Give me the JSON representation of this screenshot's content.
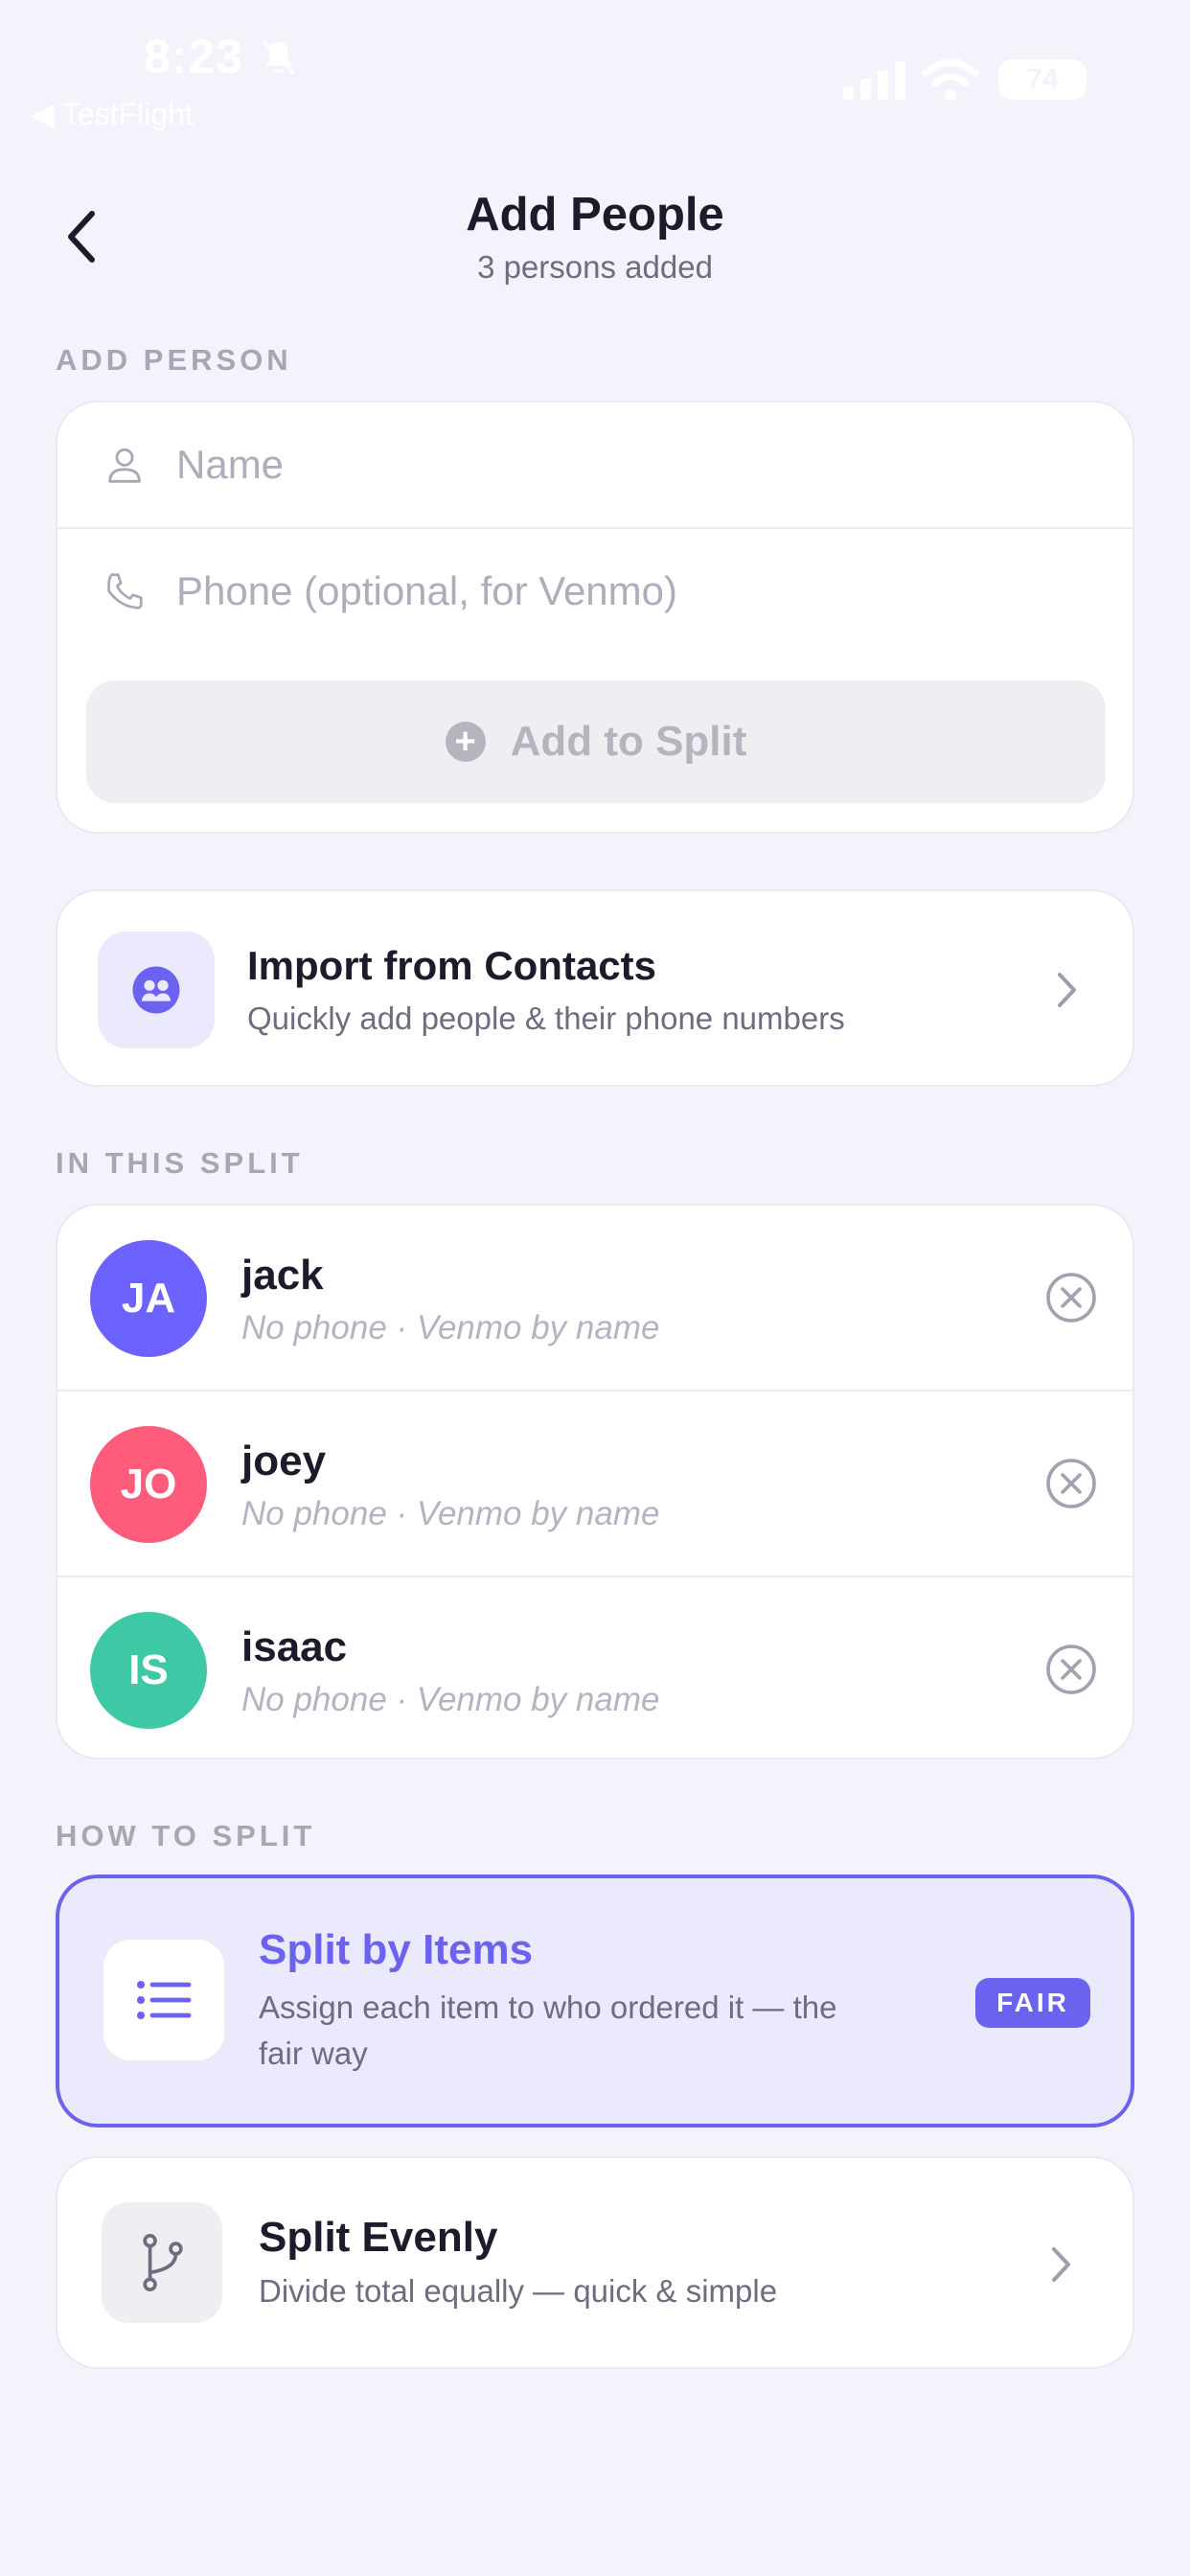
{
  "status_bar": {
    "time": "8:23",
    "back_app": "◀ TestFlight",
    "battery": "74"
  },
  "header": {
    "title": "Add People",
    "subtitle": "3 persons added"
  },
  "add_person": {
    "section_label": "ADD PERSON",
    "name_placeholder": "Name",
    "phone_placeholder": "Phone (optional, for Venmo)",
    "add_button_label": "Add to Split"
  },
  "import": {
    "title": "Import from Contacts",
    "subtitle": "Quickly add people & their phone numbers"
  },
  "in_split": {
    "section_label": "IN THIS SPLIT",
    "people": [
      {
        "initials": "JA",
        "name": "jack",
        "meta": "No phone · Venmo by name",
        "color": "#6c63ff"
      },
      {
        "initials": "JO",
        "name": "joey",
        "meta": "No phone · Venmo by name",
        "color": "#ff5c7c"
      },
      {
        "initials": "IS",
        "name": "isaac",
        "meta": "No phone · Venmo by name",
        "color": "#3fc8a5"
      }
    ]
  },
  "how_to_split": {
    "section_label": "HOW TO SPLIT",
    "by_items": {
      "title": "Split by Items",
      "subtitle_line1": "Assign each item to who ordered it — the",
      "subtitle_line2": "fair way",
      "badge": "FAIR",
      "selected": true
    },
    "evenly": {
      "title": "Split Evenly",
      "subtitle": "Divide total equally — quick & simple"
    }
  },
  "colors": {
    "accent": "#6c62f0",
    "background": "#f4f3fc"
  }
}
